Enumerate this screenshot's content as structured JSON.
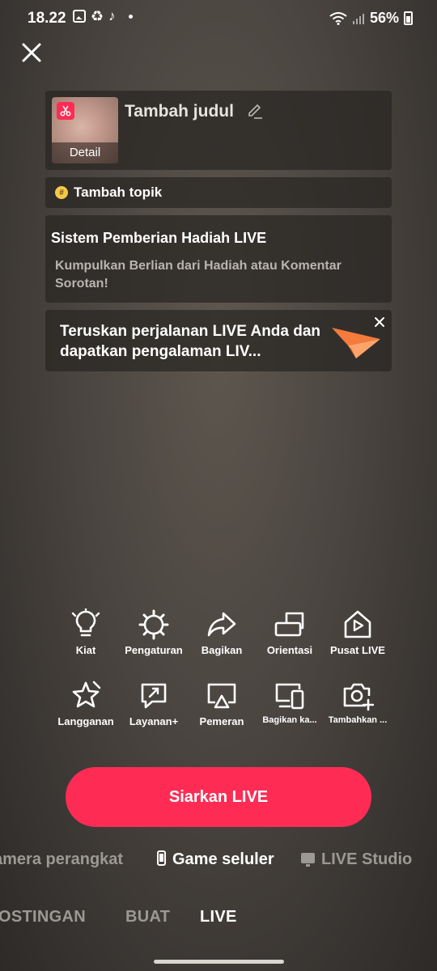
{
  "status_bar": {
    "time": "18.22",
    "battery": "56%",
    "icons": [
      "gallery-icon",
      "sync-icon",
      "tiktok-icon",
      "wifi-icon",
      "signal-icon",
      "battery-icon"
    ]
  },
  "title_card": {
    "detail_label": "Detail",
    "title": "Tambah judul"
  },
  "topic": {
    "label": "Tambah topik"
  },
  "gift": {
    "title": "Sistem Pemberian Hadiah LIVE",
    "description": "Kumpulkan Berlian dari Hadiah atau Komentar Sorotan!"
  },
  "promo": {
    "text": "Teruskan perjalanan LIVE Anda dan dapatkan pengalaman LIV..."
  },
  "actions": {
    "row1": [
      {
        "label": "Kiat",
        "icon": "lightbulb-icon"
      },
      {
        "label": "Pengaturan",
        "icon": "gear-icon"
      },
      {
        "label": "Bagikan",
        "icon": "share-icon"
      },
      {
        "label": "Orientasi",
        "icon": "orientation-icon"
      },
      {
        "label": "Pusat LIVE",
        "icon": "live-center-icon"
      }
    ],
    "row2": [
      {
        "label": "Langganan",
        "icon": "subscription-icon"
      },
      {
        "label": "Layanan+",
        "icon": "services-icon"
      },
      {
        "label": "Pemeran",
        "icon": "cast-icon"
      },
      {
        "label": "Bagikan ka...",
        "icon": "share-screen-icon"
      },
      {
        "label": "Tambahkan ...",
        "icon": "add-camera-icon"
      }
    ]
  },
  "go_live_label": "Siarkan LIVE",
  "sources": {
    "camera": "amera perangkat",
    "game": "Game seluler",
    "studio": "LIVE Studio"
  },
  "tabs": {
    "post": "OSTINGAN",
    "create": "BUAT",
    "live": "LIVE"
  },
  "colors": {
    "accent": "#fe2c55",
    "dim_text": "#9c9894"
  }
}
